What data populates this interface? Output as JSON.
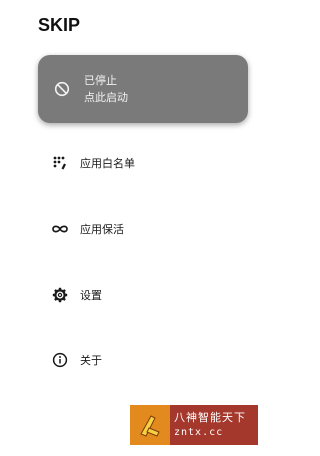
{
  "app": {
    "title": "SKIP"
  },
  "status_card": {
    "icon": "block-icon",
    "line1": "已停止",
    "line2": "点此启动",
    "background": "#7a7a7a"
  },
  "menu": {
    "items": [
      {
        "icon": "apps-grid-icon",
        "label": "应用白名单"
      },
      {
        "icon": "infinity-icon",
        "label": "应用保活"
      },
      {
        "icon": "gear-icon",
        "label": "设置"
      },
      {
        "icon": "info-icon",
        "label": "关于"
      }
    ]
  },
  "watermark": {
    "title": "八神智能天下",
    "url": "zntx.cc",
    "background": "#a5382c",
    "logo_color": "#e38a1f"
  }
}
